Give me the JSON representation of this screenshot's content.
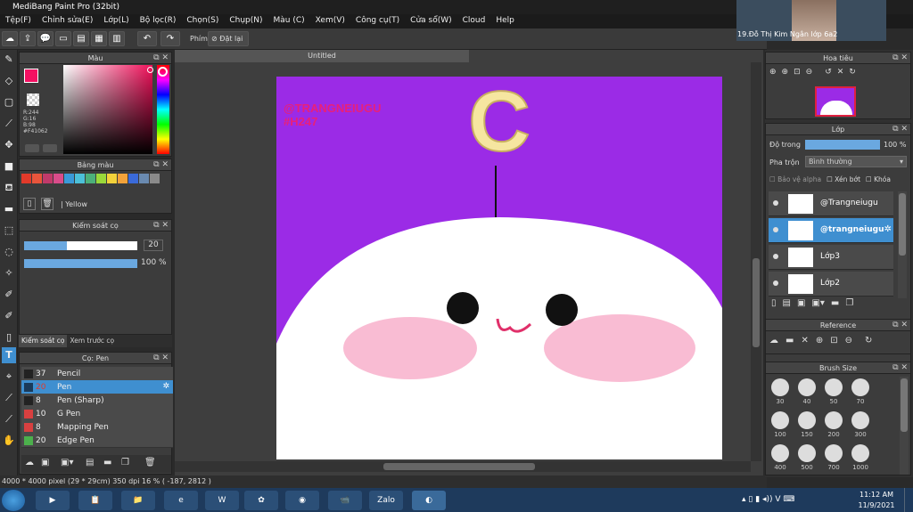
{
  "window": {
    "title": "MediBang Paint Pro (32bit)"
  },
  "menu": [
    "Tệp(F)",
    "Chỉnh sửa(E)",
    "Lớp(L)",
    "Bộ lọc(R)",
    "Chọn(S)",
    "Chụp(N)",
    "Màu (C)",
    "Xem(V)",
    "Công cụ(T)",
    "Cửa sổ(W)",
    "Cloud",
    "Help"
  ],
  "toolbar": {
    "shortcut_label": "Phím",
    "reset_label": "Đặt lại"
  },
  "color_panel": {
    "title": "Màu",
    "r": "R:244",
    "g": "G:16",
    "b": "B:98",
    "hex": "#F41062",
    "fg_color": "#F41062"
  },
  "palette_panel": {
    "title": "Bảng màu",
    "selected_name": "Yellow",
    "swatches": [
      "#e23a2a",
      "#e8553c",
      "#c03a6a",
      "#d94c8a",
      "#3a9ad9",
      "#4cc0d9",
      "#4cb07a",
      "#9ad93a",
      "#f2d13a",
      "#f2a23a",
      "#3a6ad9",
      "#6a8ab0",
      "#8a8a8a"
    ]
  },
  "brush_control": {
    "title": "Kiểm soát cọ",
    "size": "20",
    "opacity": "100 %",
    "size_fraction": 0.38,
    "opacity_fraction": 1.0
  },
  "tabs": {
    "brush_control": "Kiểm soát cọ",
    "preview": "Xem trước cọ"
  },
  "brush_panel": {
    "title": "Cọ: Pen",
    "items": [
      {
        "size": "37",
        "name": "Pencil",
        "color": "#222222"
      },
      {
        "size": "20",
        "name": "Pen",
        "color": "#1a3a5a",
        "selected": true
      },
      {
        "size": "8",
        "name": "Pen (Sharp)",
        "color": "#222222"
      },
      {
        "size": "10",
        "name": "G Pen",
        "color": "#d94040"
      },
      {
        "size": "8",
        "name": "Mapping Pen",
        "color": "#d94040"
      },
      {
        "size": "20",
        "name": "Edge Pen",
        "color": "#4cb04c"
      }
    ]
  },
  "document": {
    "tab_title": "Untitled",
    "bg_color": "#9b2be6",
    "watermark_line1": "@TRANGNEIUGU",
    "watermark_line2": "#H247",
    "letter": "C"
  },
  "status": {
    "size": "4000 * 4000 pixel",
    "cm": "(29 * 29cm)",
    "dpi": "350 dpi",
    "zoom": "16 %",
    "coords": "( -187, 2812 )"
  },
  "navigator": {
    "title": "Hoa tiêu"
  },
  "layer_panel": {
    "title": "Lớp",
    "opacity_label": "Độ trong",
    "opacity_value": "100 %",
    "blend_label": "Pha trộn",
    "blend_value": "Bình thường",
    "protect_alpha": "Bảo vệ alpha",
    "clipping": "Xén bớt",
    "lock": "Khóa",
    "layers": [
      {
        "name": "@Trangneiugu",
        "selected": false
      },
      {
        "name": "@trangneiugu",
        "selected": true
      },
      {
        "name": "Lớp3",
        "selected": false
      },
      {
        "name": "Lớp2",
        "selected": false
      }
    ]
  },
  "reference_panel": {
    "title": "Reference"
  },
  "brush_size_panel": {
    "title": "Brush Size",
    "sizes": [
      "30",
      "40",
      "50",
      "70",
      "100",
      "150",
      "200",
      "300",
      "400",
      "500",
      "700",
      "1000"
    ]
  },
  "video": {
    "caption": "19.Đỗ Thị Kim Ngân lớp 6a2"
  },
  "taskbar": {
    "time": "11:12 AM",
    "date": "11/9/2021",
    "zalo": "Zalo"
  }
}
